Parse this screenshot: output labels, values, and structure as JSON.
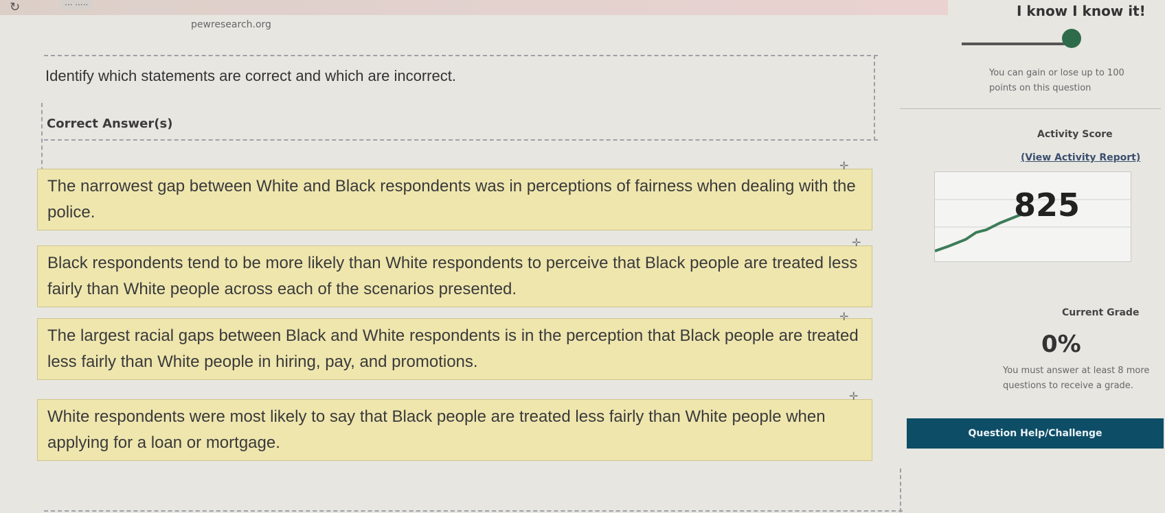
{
  "browser": {
    "url": "pewresearch.org",
    "tab_label": "··· ·····"
  },
  "question": {
    "prompt": "Identify which statements are correct and which are incorrect.",
    "correct_zone_label": "Correct Answer(s)"
  },
  "statements": [
    {
      "text": "The narrowest gap between White and Black respondents was in perceptions of fairness when dealing with the police."
    },
    {
      "text": "Black respondents tend to be more likely than White respondents to perceive that Black people are treated less fairly than White people across each of the scenarios presented."
    },
    {
      "text": "The largest racial gaps between Black and White respondents is in the perception that Black people are treated less fairly than White people in hiring, pay, and promotions."
    },
    {
      "text": "White respondents were most likely to say that Black people are treated less fairly than White people when applying for a loan or mortgage."
    }
  ],
  "sidebar": {
    "title": "I know I know it!",
    "points_note": "You can gain or lose up to 100 points on this question",
    "activity_label": "Activity Score",
    "report_link": "(View Activity Report)",
    "score": "825",
    "grade_label": "Current Grade",
    "grade": "0%",
    "grade_note": "You must answer at least 8 more questions to receive a grade.",
    "help_button": "Question Help/Challenge"
  },
  "icons": {
    "refresh": "refresh-icon",
    "drag": "drag-handle-icon"
  },
  "colors": {
    "statement_bg": "#efe6ae",
    "help_button_bg": "#0e4d66",
    "progress_knob": "#2e6b4a"
  }
}
